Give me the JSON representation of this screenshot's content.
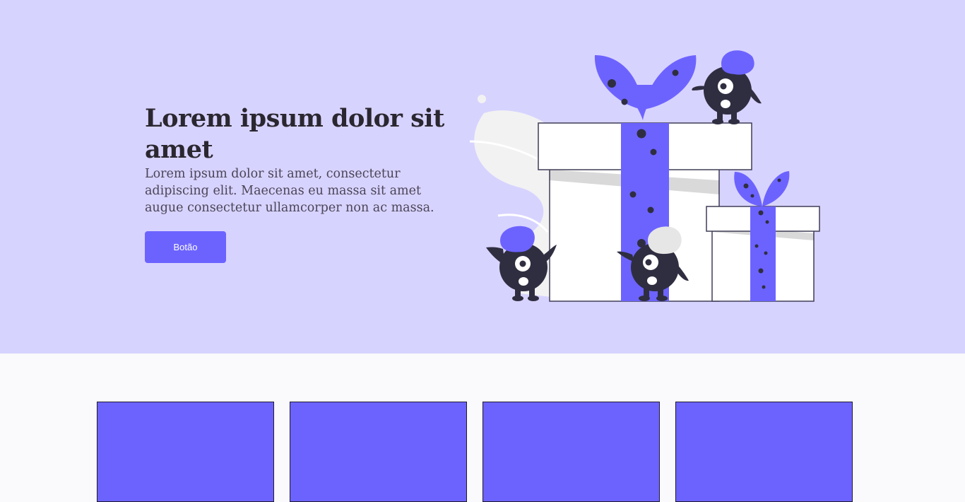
{
  "hero": {
    "title": "Lorem ipsum dolor sit amet",
    "description": "Lorem ipsum dolor sit amet, consectetur adipiscing elit. Maecenas eu massa sit amet augue consectetur ullamcorper non ac massa.",
    "button_label": "Botão",
    "illustration_icon": "gift-boxes-monsters-illustration"
  },
  "colors": {
    "hero_background": "#d7d3ff",
    "accent": "#6c63ff",
    "dark": "#2f2e41",
    "page_background": "#faf9fb"
  },
  "cards": [
    {
      "name": "card-1"
    },
    {
      "name": "card-2"
    },
    {
      "name": "card-3"
    },
    {
      "name": "card-4"
    }
  ]
}
